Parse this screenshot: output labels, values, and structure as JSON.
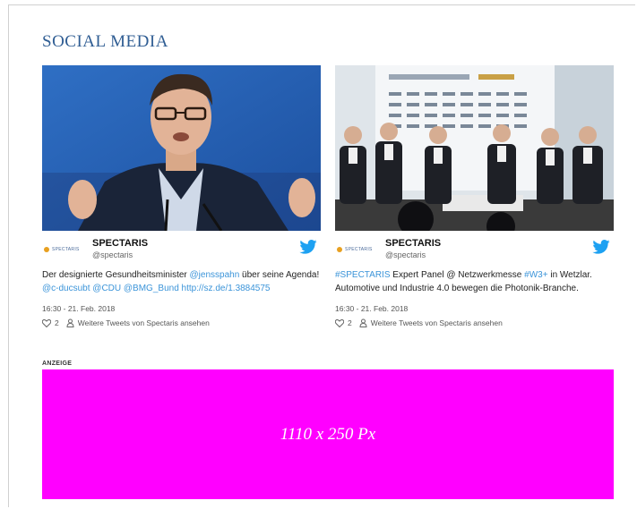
{
  "section": {
    "title": "SOCIAL MEDIA"
  },
  "tweets": [
    {
      "logo_text": "SPECTARIS",
      "name": "SPECTARIS",
      "handle": "@spectaris",
      "text_parts": [
        {
          "t": "Der designierte Gesundheitsminister ",
          "link": false
        },
        {
          "t": "@jensspahn",
          "link": true
        },
        {
          "t": " über seine Agenda! ",
          "link": false
        },
        {
          "t": "@c-ducsubt",
          "link": true
        },
        {
          "t": " @CDU",
          "link": true
        },
        {
          "t": " @BMG_Bund",
          "link": true
        },
        {
          "t": " http://sz.de/1.3884575",
          "link": true
        }
      ],
      "date": "16:30 - 21. Feb. 2018",
      "likes": "2",
      "more_link": "Weitere Tweets von Spectaris ansehen"
    },
    {
      "logo_text": "SPECTARIS",
      "name": "SPECTARIS",
      "handle": "@spectaris",
      "text_parts": [
        {
          "t": "#SPECTARIS",
          "link": true
        },
        {
          "t": " Expert Panel @ Netzwerkmesse ",
          "link": false
        },
        {
          "t": "#W3+",
          "link": true
        },
        {
          "t": " in Wetzlar. Automotive und Industrie 4.0 bewegen die Photonik-Branche.",
          "link": false
        }
      ],
      "date": "16:30 - 21. Feb. 2018",
      "likes": "2",
      "more_link": "Weitere Tweets von Spectaris ansehen"
    }
  ],
  "ad": {
    "label": "ANZEIGE",
    "placeholder": "1110 x 250 Px",
    "color": "#ff00ff"
  },
  "colors": {
    "title": "#2f5d93",
    "link": "#3b94d9",
    "twitter": "#1da1f2"
  }
}
